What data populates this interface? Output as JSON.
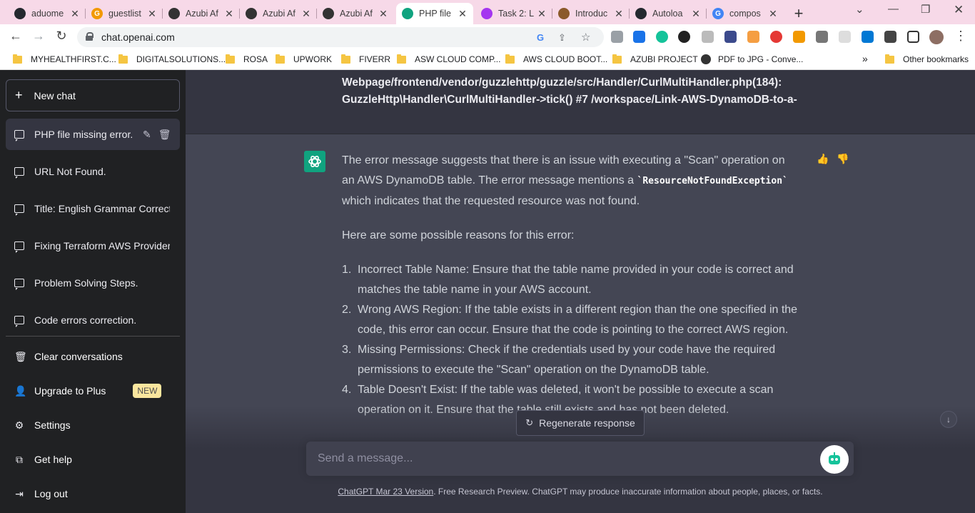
{
  "browser": {
    "tabs": [
      {
        "title": "aduome",
        "icon": "github-icon",
        "color": "#24292f"
      },
      {
        "title": "guestlist",
        "icon": "google-icon",
        "color": "#f29900"
      },
      {
        "title": "Azubi Af",
        "icon": "globe-icon",
        "color": "#333333"
      },
      {
        "title": "Azubi Af",
        "icon": "globe-icon",
        "color": "#333333"
      },
      {
        "title": "Azubi Af",
        "icon": "globe-icon",
        "color": "#333333"
      },
      {
        "title": "PHP file",
        "icon": "openai-icon",
        "color": "#10a37f"
      },
      {
        "title": "Task 2: L",
        "icon": "udemy-icon",
        "color": "#a435f0"
      },
      {
        "title": "Introduc",
        "icon": "course-icon",
        "color": "#8b5a2b"
      },
      {
        "title": "Autoloa",
        "icon": "github-icon",
        "color": "#24292f"
      },
      {
        "title": "compos",
        "icon": "google-icon",
        "color": "#4285f4"
      }
    ],
    "url": "chat.openai.com",
    "bookmarks": [
      "MYHEALTHFIRST.C...",
      "DIGITALSOLUTIONS...",
      "ROSA",
      "UPWORK",
      "FIVERR",
      "ASW CLOUD COMP...",
      "AWS CLOUD BOOT...",
      "AZUBI PROJECT",
      "PDF to JPG - Conve...",
      "Other bookmarks"
    ],
    "bookmarks_overflow": "»"
  },
  "sidebar": {
    "new_chat": "New chat",
    "conversations": [
      "PHP file missing error.",
      "URL Not Found.",
      "Title: English Grammar Correction",
      "Fixing Terraform AWS Provider",
      "Problem Solving Steps.",
      "Code errors correction."
    ],
    "clear": "Clear conversations",
    "upgrade": "Upgrade to Plus",
    "upgrade_badge": "NEW",
    "settings": "Settings",
    "help": "Get help",
    "logout": "Log out"
  },
  "chat": {
    "user_lines": [
      "Webpage/frontend/vendor/guzzlehttp/guzzle/src/Handler/CurlMultiHandler.php(184):",
      "GuzzleHttp\\Handler\\CurlMultiHandler->tick() #7 /workspace/Link-AWS-DynamoDB-to-a-"
    ],
    "para1_before": "The error message suggests that there is an issue with executing a \"Scan\" operation on an AWS DynamoDB table. The error message mentions a ",
    "para1_code": "`ResourceNotFoundException`",
    "para1_after": " which indicates that the requested resource was not found.",
    "para2": "Here are some possible reasons for this error:",
    "reasons": [
      {
        "num": "1.",
        "text": "Incorrect Table Name: Ensure that the table name provided in your code is correct and matches the table name in your AWS account."
      },
      {
        "num": "2.",
        "text": "Wrong AWS Region: If the table exists in a different region than the one specified in the code, this error can occur. Ensure that the code is pointing to the correct AWS region."
      },
      {
        "num": "3.",
        "text": "Missing Permissions: Check if the credentials used by your code have the required permissions to execute the \"Scan\" operation on the DynamoDB table."
      },
      {
        "num": "4.",
        "text": "Table Doesn't Exist: If the table was deleted, it won't be possible to execute a scan operation on it. Ensure that the table still exists and has not been deleted."
      }
    ],
    "regenerate": "Regenerate response",
    "input_placeholder": "Send a message...",
    "footer_link": "ChatGPT Mar 23 Version",
    "footer_text": ". Free Research Preview. ChatGPT may produce inaccurate information about people, places, or facts."
  },
  "colors": {
    "sidebar_bg": "#202123",
    "main_bg": "#343541",
    "bot_bg": "#444654",
    "accent": "#10a37f",
    "badge": "#fae69e"
  }
}
